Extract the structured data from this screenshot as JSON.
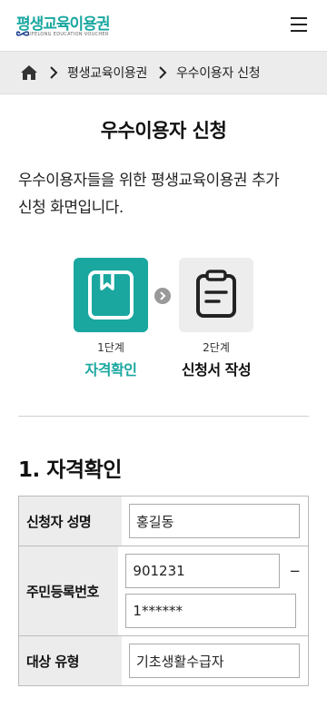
{
  "header": {
    "logo_text": "평생교육이용권",
    "logo_sub": "LIFELONG EDUCATION VOUCHER",
    "menu_icon": "hamburger-icon"
  },
  "breadcrumb": {
    "home_icon": "home-icon",
    "items": [
      "평생교육이용권",
      "우수이용자 신청"
    ]
  },
  "page": {
    "title": "우수이용자 신청",
    "description": "우수이용자들을 위한 평생교육이용권 추가 신청 화면입니다."
  },
  "steps": [
    {
      "num": "1단계",
      "name": "자격확인",
      "icon": "bookmark-book-icon",
      "active": true
    },
    {
      "num": "2단계",
      "name": "신청서 작성",
      "icon": "clipboard-icon",
      "active": false
    }
  ],
  "section": {
    "title": "1. 자격확인"
  },
  "form": {
    "name_label": "신청자 성명",
    "name_value": "홍길동",
    "ssn_label": "주민등록번호",
    "ssn_front": "901231",
    "ssn_dash": "−",
    "ssn_back": "1******",
    "type_label": "대상 유형",
    "type_value": "기초생활수급자"
  },
  "colors": {
    "accent": "#1aa7a0",
    "breadcrumb_bg": "#ececec",
    "label_bg": "#ececec"
  }
}
